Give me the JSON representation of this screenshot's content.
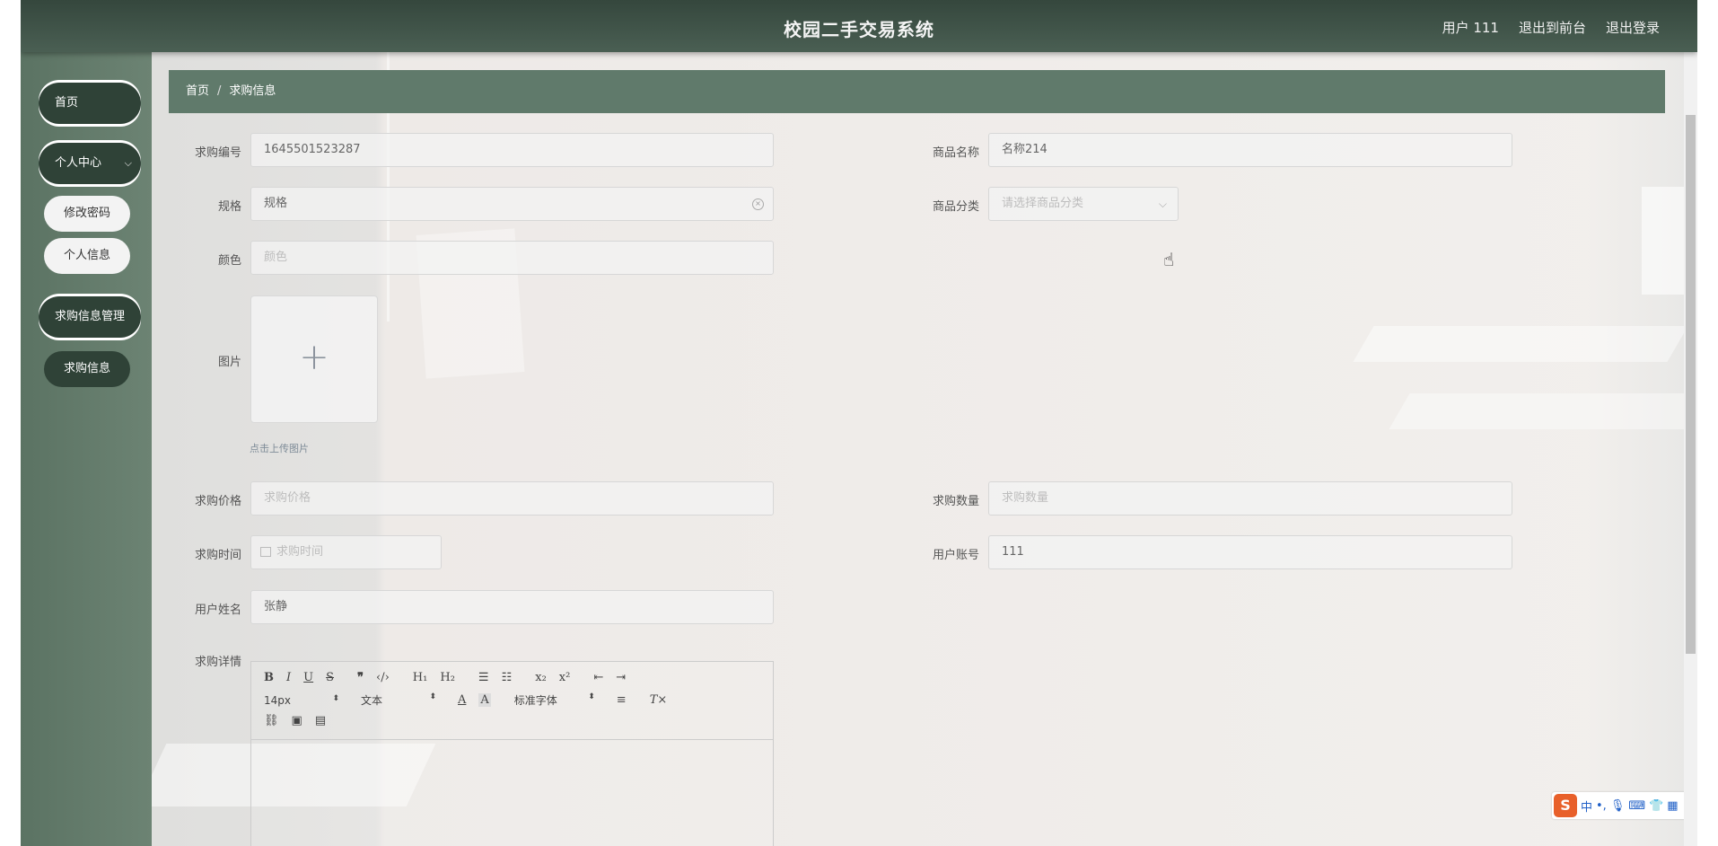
{
  "header": {
    "title": "校园二手交易系统",
    "user": "用户 111",
    "exit_front": "退出到前台",
    "logout": "退出登录"
  },
  "sidebar": {
    "home": "首页",
    "personal_center": "个人中心",
    "change_password": "修改密码",
    "personal_info": "个人信息",
    "purchase_mgmt": "求购信息管理",
    "purchase_info": "求购信息"
  },
  "breadcrumb": {
    "home": "首页",
    "separator": "/",
    "current": "求购信息"
  },
  "form": {
    "purchase_no": {
      "label": "求购编号",
      "value": "1645501523287"
    },
    "product_name": {
      "label": "商品名称",
      "value": "名称214"
    },
    "spec": {
      "label": "规格",
      "value": "规格"
    },
    "category": {
      "label": "商品分类",
      "placeholder": "请选择商品分类"
    },
    "color": {
      "label": "颜色",
      "placeholder": "颜色"
    },
    "image": {
      "label": "图片",
      "tip": "点击上传图片"
    },
    "price": {
      "label": "求购价格",
      "placeholder": "求购价格"
    },
    "quantity": {
      "label": "求购数量",
      "placeholder": "求购数量"
    },
    "time": {
      "label": "求购时间",
      "placeholder": "求购时间"
    },
    "account": {
      "label": "用户账号",
      "value": "111"
    },
    "username": {
      "label": "用户姓名",
      "value": "张静"
    },
    "details": {
      "label": "求购详情"
    }
  },
  "editor": {
    "font_size": "14px",
    "text_type": "文本",
    "font_family": "标准字体"
  },
  "ime": {
    "lang": "中"
  }
}
